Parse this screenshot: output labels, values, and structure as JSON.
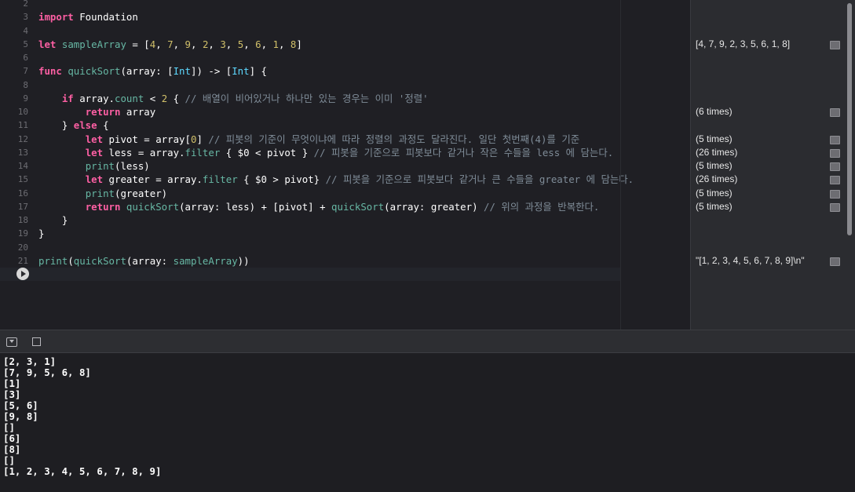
{
  "editor": {
    "lines": [
      {
        "n": "2",
        "tokens": []
      },
      {
        "n": "3",
        "tokens": [
          [
            "kw",
            "import"
          ],
          [
            "pl",
            " Foundation"
          ]
        ]
      },
      {
        "n": "4",
        "tokens": []
      },
      {
        "n": "5",
        "tokens": [
          [
            "kw",
            "let"
          ],
          [
            "pl",
            " "
          ],
          [
            "fn",
            "sampleArray"
          ],
          [
            "pl",
            " = ["
          ],
          [
            "num",
            "4"
          ],
          [
            "pl",
            ", "
          ],
          [
            "num",
            "7"
          ],
          [
            "pl",
            ", "
          ],
          [
            "num",
            "9"
          ],
          [
            "pl",
            ", "
          ],
          [
            "num",
            "2"
          ],
          [
            "pl",
            ", "
          ],
          [
            "num",
            "3"
          ],
          [
            "pl",
            ", "
          ],
          [
            "num",
            "5"
          ],
          [
            "pl",
            ", "
          ],
          [
            "num",
            "6"
          ],
          [
            "pl",
            ", "
          ],
          [
            "num",
            "1"
          ],
          [
            "pl",
            ", "
          ],
          [
            "num",
            "8"
          ],
          [
            "pl",
            "]"
          ]
        ]
      },
      {
        "n": "6",
        "tokens": []
      },
      {
        "n": "7",
        "tokens": [
          [
            "kw",
            "func"
          ],
          [
            "pl",
            " "
          ],
          [
            "fn",
            "quickSort"
          ],
          [
            "pl",
            "(array: ["
          ],
          [
            "ty",
            "Int"
          ],
          [
            "pl",
            "]) -> ["
          ],
          [
            "ty",
            "Int"
          ],
          [
            "pl",
            "] {"
          ]
        ]
      },
      {
        "n": "8",
        "tokens": []
      },
      {
        "n": "9",
        "tokens": [
          [
            "pl",
            "    "
          ],
          [
            "kw",
            "if"
          ],
          [
            "pl",
            " array."
          ],
          [
            "prop",
            "count"
          ],
          [
            "pl",
            " < "
          ],
          [
            "num",
            "2"
          ],
          [
            "pl",
            " { "
          ],
          [
            "cm",
            "// 배열이 비어있거나 하나만 있는 경우는 이미 '정렬'"
          ]
        ]
      },
      {
        "n": "10",
        "tokens": [
          [
            "pl",
            "        "
          ],
          [
            "kw",
            "return"
          ],
          [
            "pl",
            " array"
          ]
        ]
      },
      {
        "n": "11",
        "tokens": [
          [
            "pl",
            "    } "
          ],
          [
            "kw",
            "else"
          ],
          [
            "pl",
            " {"
          ]
        ]
      },
      {
        "n": "12",
        "tokens": [
          [
            "pl",
            "        "
          ],
          [
            "kw",
            "let"
          ],
          [
            "pl",
            " pivot = array["
          ],
          [
            "num",
            "0"
          ],
          [
            "pl",
            "] "
          ],
          [
            "cm",
            "// 피봇의 기준이 무엇이냐에 따라 정렬의 과정도 달라진다. 일단 첫번째(4)를 기준"
          ]
        ]
      },
      {
        "n": "13",
        "tokens": [
          [
            "pl",
            "        "
          ],
          [
            "kw",
            "let"
          ],
          [
            "pl",
            " less = array."
          ],
          [
            "prop",
            "filter"
          ],
          [
            "pl",
            " { $0 < pivot } "
          ],
          [
            "cm",
            "// 피봇을 기준으로 피봇보다 같거나 작은 수들을 less 에 담는다."
          ]
        ]
      },
      {
        "n": "14",
        "tokens": [
          [
            "pl",
            "        "
          ],
          [
            "fn",
            "print"
          ],
          [
            "pl",
            "(less)"
          ]
        ]
      },
      {
        "n": "15",
        "tokens": [
          [
            "pl",
            "        "
          ],
          [
            "kw",
            "let"
          ],
          [
            "pl",
            " greater = array."
          ],
          [
            "prop",
            "filter"
          ],
          [
            "pl",
            " { $0 > pivot} "
          ],
          [
            "cm",
            "// 피봇을 기준으로 피봇보다 같거나 큰 수들을 greater 에 담는다."
          ]
        ]
      },
      {
        "n": "16",
        "tokens": [
          [
            "pl",
            "        "
          ],
          [
            "fn",
            "print"
          ],
          [
            "pl",
            "(greater)"
          ]
        ]
      },
      {
        "n": "17",
        "tokens": [
          [
            "pl",
            "        "
          ],
          [
            "kw",
            "return"
          ],
          [
            "pl",
            " "
          ],
          [
            "fn",
            "quickSort"
          ],
          [
            "pl",
            "(array: less) + [pivot] + "
          ],
          [
            "fn",
            "quickSort"
          ],
          [
            "pl",
            "(array: greater) "
          ],
          [
            "cm",
            "// 위의 과정을 반복한다."
          ]
        ]
      },
      {
        "n": "18",
        "tokens": [
          [
            "pl",
            "    }"
          ]
        ]
      },
      {
        "n": "19",
        "tokens": [
          [
            "pl",
            "}"
          ]
        ]
      },
      {
        "n": "20",
        "tokens": []
      },
      {
        "n": "21",
        "tokens": [
          [
            "fn",
            "print"
          ],
          [
            "pl",
            "("
          ],
          [
            "fn",
            "quickSort"
          ],
          [
            "pl",
            "(array: "
          ],
          [
            "fn",
            "sampleArray"
          ],
          [
            "pl",
            "))"
          ]
        ]
      }
    ]
  },
  "results": [
    {
      "line": "5",
      "text": "[4, 7, 9, 2, 3, 5, 6, 1, 8]"
    },
    {
      "line": "10",
      "text": "(6 times)"
    },
    {
      "line": "12",
      "text": "(5 times)"
    },
    {
      "line": "13",
      "text": "(26 times)"
    },
    {
      "line": "14",
      "text": "(5 times)"
    },
    {
      "line": "15",
      "text": "(26 times)"
    },
    {
      "line": "16",
      "text": "(5 times)"
    },
    {
      "line": "17",
      "text": "(5 times)"
    },
    {
      "line": "21",
      "text": "\"[1, 2, 3, 4, 5, 6, 7, 8, 9]\\n\""
    }
  ],
  "console": {
    "lines": [
      "[2, 3, 1]",
      "[7, 9, 5, 6, 8]",
      "[1]",
      "[3]",
      "[5, 6]",
      "[9, 8]",
      "[]",
      "[6]",
      "[8]",
      "[]",
      "[1, 2, 3, 4, 5, 6, 7, 8, 9]"
    ]
  },
  "icons": {
    "run": "play-icon",
    "hide_console": "hide-console-icon",
    "clear_console": "clear-console-icon",
    "quick_look": "quick-look-icon"
  },
  "colors": {
    "keyword": "#fc5fa3",
    "function": "#67b7a4",
    "type": "#5dd8ff",
    "number": "#d0bf69",
    "comment": "#7f8c98",
    "background": "#1f1f24"
  }
}
